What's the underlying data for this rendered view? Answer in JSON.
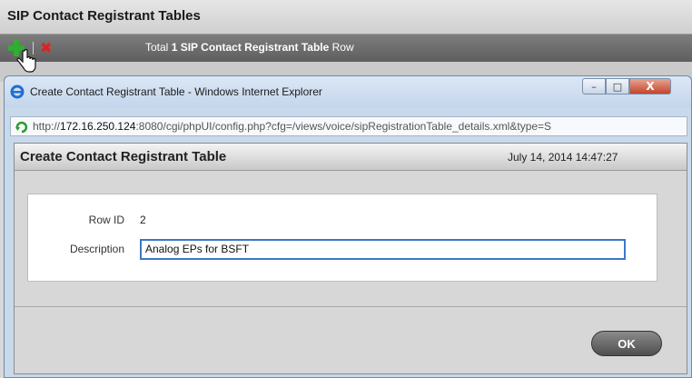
{
  "background": {
    "page_title": "SIP Contact Registrant Tables",
    "toolbar": {
      "total_prefix": "Total ",
      "total_count": "1",
      "total_mid": " SIP Contact Registrant Table",
      "total_suffix": " Row",
      "add_icon": "plus-icon",
      "delete_icon": "x-icon"
    }
  },
  "window": {
    "title": "Create Contact Registrant Table - Windows Internet Explorer",
    "url_prefix": "http://",
    "url_host": "172.16.250.124",
    "url_rest": ":8080/cgi/phpUI/config.php?cfg=/views/voice/sipRegistrationTable_details.xml&type=S",
    "controls": {
      "minimize": "–",
      "maximize": "□",
      "close": "X"
    }
  },
  "dialog": {
    "title": "Create Contact Registrant Table",
    "timestamp": "July 14, 2014 14:47:27",
    "fields": {
      "row_id_label": "Row ID",
      "row_id_value": "2",
      "description_label": "Description",
      "description_value": "Analog EPs for BSFT"
    },
    "ok_label": "OK"
  }
}
